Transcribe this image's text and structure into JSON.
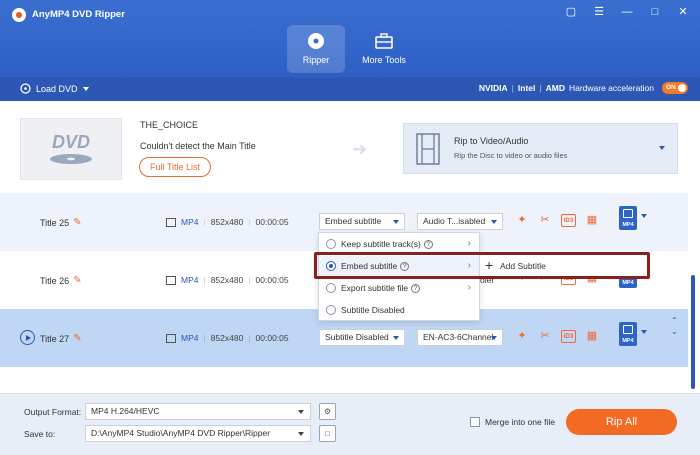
{
  "app": {
    "title": "AnyMP4 DVD Ripper"
  },
  "nav": {
    "tabs": [
      {
        "label": "Ripper",
        "active": true
      },
      {
        "label": "More Tools",
        "active": false
      }
    ]
  },
  "toolbar": {
    "load_dvd": "Load DVD",
    "hw_brands": [
      "NVIDIA",
      "Intel",
      "AMD"
    ],
    "hw_label": "Hardware acceleration",
    "hw_toggle": "ON"
  },
  "source": {
    "thumb_label": "DVD",
    "disc_title": "THE_CHOICE",
    "message": "Couldn't detect the Main Title",
    "full_title_button": "Full Title List",
    "rip_to_title": "Rip to Video/Audio",
    "rip_to_sub": "Rip the Disc to video or audio files"
  },
  "rows": [
    {
      "title": "Title 25",
      "format": "MP4",
      "resolution": "852x480",
      "duration": "00:00:05",
      "subtitle": "Embed subtitle",
      "audio": "Audio T...isabled",
      "badge": "MP4"
    },
    {
      "title": "Title 26",
      "format": "MP4",
      "resolution": "852x480",
      "duration": "00:00:05",
      "audio_partial": "oler",
      "badge": "MP4"
    },
    {
      "title": "Title 27",
      "format": "MP4",
      "resolution": "852x480",
      "duration": "00:00:05",
      "subtitle": "Subtitle Disabled",
      "audio": "EN-AC3-6Channel",
      "badge": "MP4"
    }
  ],
  "dropdown": {
    "items": [
      {
        "label": "Keep subtitle track(s)",
        "selected": false
      },
      {
        "label": "Embed subtitle",
        "selected": true
      },
      {
        "label": "Export subtitle file",
        "selected": false
      },
      {
        "label": "Subtitle Disabled",
        "selected": false
      }
    ],
    "submenu": {
      "add_subtitle": "Add Subtitle"
    }
  },
  "footer": {
    "output_format_label": "Output Format:",
    "output_format_value": "MP4 H.264/HEVC",
    "save_to_label": "Save to:",
    "save_to_value": "D:\\AnyMP4 Studio\\AnyMP4 DVD Ripper\\Ripper",
    "merge_label": "Merge into one file",
    "rip_all": "Rip All"
  },
  "colors": {
    "accent": "#2c57b4",
    "action": "#f06a35",
    "highlight_frame": "#8a1f1f"
  }
}
